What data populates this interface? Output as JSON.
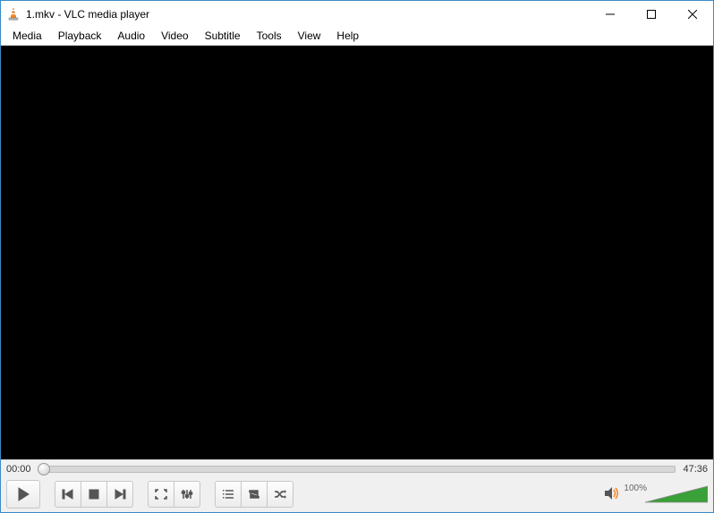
{
  "window": {
    "title": "1.mkv - VLC media player"
  },
  "menu": {
    "items": [
      "Media",
      "Playback",
      "Audio",
      "Video",
      "Subtitle",
      "Tools",
      "View",
      "Help"
    ]
  },
  "player": {
    "elapsed": "00:00",
    "duration": "47:36"
  },
  "volume": {
    "percent": "100%"
  }
}
